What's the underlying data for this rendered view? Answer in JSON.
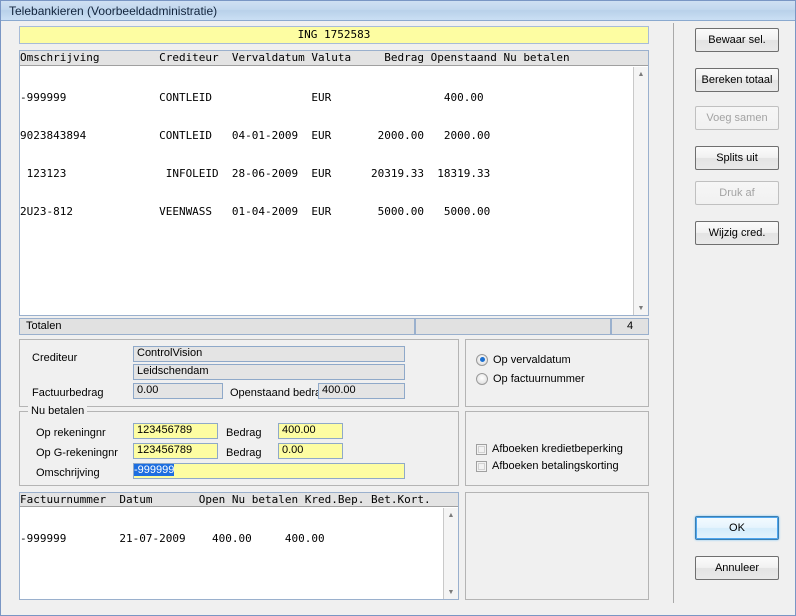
{
  "window": {
    "title": "Telebankieren (Voorbeeldadministratie)"
  },
  "account_banner": {
    "text": "ING 1752583"
  },
  "grid": {
    "header": "Omschrijving         Crediteur  Vervaldatum Valuta     Bedrag Openstaand Nu betalen",
    "rows": [
      "-999999              CONTLEID               EUR                 400.00           ",
      "9023843894           CONTLEID   04-01-2009  EUR       2000.00   2000.00           ",
      " 123123               INFOLEID  28-06-2009  EUR      20319.33  18319.33           ",
      "2U23-812             VEENWASS   01-04-2009  EUR       5000.00   5000.00           "
    ],
    "columns": [
      "Omschrijving",
      "Crediteur",
      "Vervaldatum",
      "Valuta",
      "Bedrag",
      "Openstaand",
      "Nu betalen"
    ],
    "data": [
      {
        "omschrijving": "-999999",
        "crediteur": "CONTLEID",
        "vervaldatum": "",
        "valuta": "EUR",
        "bedrag": "",
        "openstaand": "400.00",
        "nu_betalen": ""
      },
      {
        "omschrijving": "9023843894",
        "crediteur": "CONTLEID",
        "vervaldatum": "04-01-2009",
        "valuta": "EUR",
        "bedrag": "2000.00",
        "openstaand": "2000.00",
        "nu_betalen": ""
      },
      {
        "omschrijving": "123123",
        "crediteur": "INFOLEID",
        "vervaldatum": "28-06-2009",
        "valuta": "EUR",
        "bedrag": "20319.33",
        "openstaand": "18319.33",
        "nu_betalen": ""
      },
      {
        "omschrijving": "2U23-812",
        "crediteur": "VEENWASS",
        "vervaldatum": "01-04-2009",
        "valuta": "EUR",
        "bedrag": "5000.00",
        "openstaand": "5000.00",
        "nu_betalen": ""
      }
    ]
  },
  "totals": {
    "label": "Totalen",
    "middle": "",
    "count": "4"
  },
  "creditor": {
    "label_crediteur": "Crediteur",
    "name": "ControlVision",
    "city": "Leidschendam",
    "label_factuurbedrag": "Factuurbedrag",
    "factuurbedrag": "0.00",
    "label_openstaand": "Openstaand bedrag",
    "openstaand_bedrag": "400.00"
  },
  "nu_betalen": {
    "legend": "Nu betalen",
    "label_rekeningnr": "Op rekeningnr",
    "rekeningnr": "123456789",
    "label_bedrag1": "Bedrag",
    "bedrag1": "400.00",
    "label_grekeningnr": "Op G-rekeningnr",
    "grekeningnr": "123456789",
    "label_bedrag2": "Bedrag",
    "bedrag2": "0.00",
    "label_omschrijving": "Omschrijving",
    "omschrijving_selected": "-999999"
  },
  "sort_options": {
    "vervaldatum": "Op vervaldatum",
    "factuurnummer": "Op factuurnummer",
    "selected": "Op vervaldatum"
  },
  "writeoff_options": {
    "kredietbeperking": "Afboeken kredietbeperking",
    "betalingskorting": "Afboeken betalingskorting"
  },
  "sub_grid": {
    "header": "Factuurnummer  Datum       Open Nu betalen Kred.Bep. Bet.Kort.",
    "rows": [
      "-999999        21-07-2009    400.00     400.00                      "
    ],
    "columns": [
      "Factuurnummer",
      "Datum",
      "Open",
      "Nu betalen",
      "Kred.Bep.",
      "Bet.Kort."
    ],
    "data": [
      {
        "factuurnummer": "-999999",
        "datum": "21-07-2009",
        "open": "400.00",
        "nu_betalen": "400.00",
        "kred_bep": "",
        "bet_kort": ""
      }
    ]
  },
  "side_buttons": [
    {
      "label": "Bewaar sel.",
      "disabled": false
    },
    {
      "label": "Bereken totaal",
      "disabled": false
    },
    {
      "label": "Voeg samen",
      "disabled": true
    },
    {
      "label": "Splits uit",
      "disabled": false
    },
    {
      "label": "Druk af",
      "disabled": true
    },
    {
      "label": "Wijzig cred.",
      "disabled": false
    }
  ],
  "dialog_buttons": {
    "ok": "OK",
    "cancel": "Annuleer"
  },
  "icons": {
    "scroll_up": "▲",
    "scroll_down": "▼"
  },
  "colors": {
    "titlebar": "#c2d7ee",
    "highlight_yellow": "#fdfda2",
    "selection_blue": "#1d6ee0",
    "focus_blue": "#3c7fb1"
  }
}
